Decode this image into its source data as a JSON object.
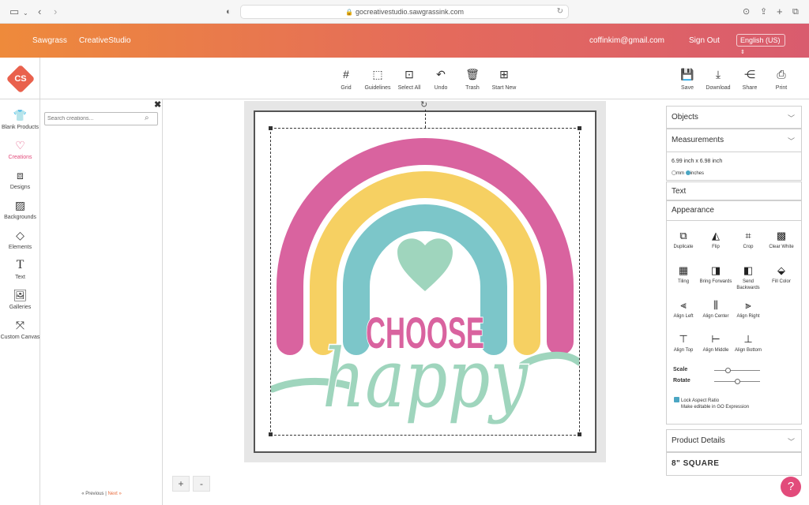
{
  "browser": {
    "url": "gocreativestudio.sawgrassink.com"
  },
  "header": {
    "brand": "Sawgrass",
    "app_name": "CreativeStudio",
    "email": "coffinkim@gmail.com",
    "sign_out": "Sign Out",
    "language": "English (US)"
  },
  "logo": {
    "text": "CS"
  },
  "toolbar": {
    "grid": "Grid",
    "guidelines": "Guidelines",
    "select_all": "Select All",
    "undo": "Undo",
    "trash": "Trash",
    "start_new": "Start New",
    "save": "Save",
    "download": "Download",
    "share": "Share",
    "print": "Print"
  },
  "left_nav": {
    "items": [
      {
        "label": "Blank Products"
      },
      {
        "label": "Creations"
      },
      {
        "label": "Designs"
      },
      {
        "label": "Backgrounds"
      },
      {
        "label": "Elements"
      },
      {
        "label": "Text"
      },
      {
        "label": "Galleries"
      },
      {
        "label": "Custom Canvas"
      }
    ]
  },
  "creations": {
    "search_placeholder": "Search creations...",
    "prev": "« Previous",
    "sep": "|",
    "next": "Next »"
  },
  "artwork": {
    "line1": "CHOOSE",
    "line2": "happy",
    "colors": {
      "pink": "#d9639f",
      "yellow": "#f6d062",
      "teal": "#7cc6c9",
      "mint": "#9fd5bd"
    }
  },
  "zoom": {
    "in": "+",
    "out": "-"
  },
  "right_panel": {
    "objects": "Objects",
    "measurements": "Measurements",
    "size": "6.99 inch x 6.98 inch",
    "unit_mm": "mm",
    "unit_inches": "inches",
    "text": "Text",
    "appearance": "Appearance",
    "appearance_items": [
      {
        "label": "Duplicate"
      },
      {
        "label": "Flip"
      },
      {
        "label": "Crop"
      },
      {
        "label": "Clear White"
      },
      {
        "label": "Tiling"
      },
      {
        "label": "Bring Forwards"
      },
      {
        "label": "Send Backwards"
      },
      {
        "label": "Fill Color"
      },
      {
        "label": "Align Left"
      },
      {
        "label": "Align Center"
      },
      {
        "label": "Align Right"
      },
      {
        "label": "Align Top"
      },
      {
        "label": "Align Middle"
      },
      {
        "label": "Align Bottom"
      }
    ],
    "scale": "Scale",
    "rotate": "Rotate",
    "lock_aspect": "Lock Aspect Ratio",
    "editable_note": "Make editable in GO Expression",
    "product_details": "Product Details",
    "product_size": "8\" SQUARE"
  },
  "help": "?"
}
